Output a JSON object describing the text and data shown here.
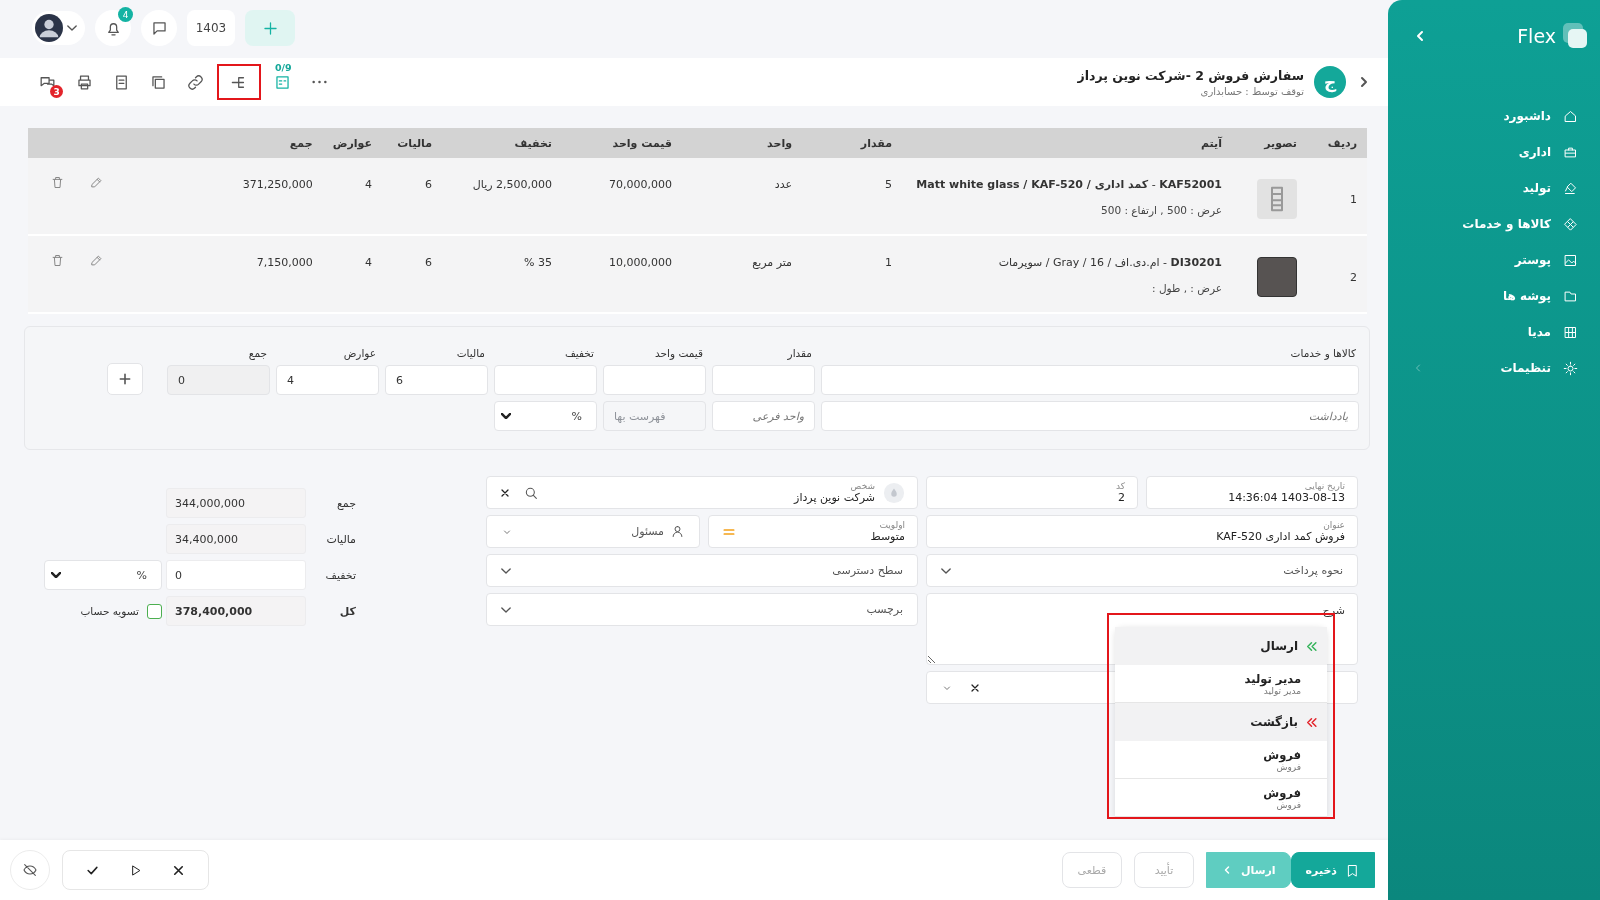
{
  "topbar": {
    "notifications": "4",
    "year": "1403"
  },
  "header": {
    "avatar_letter": "ج",
    "title": "سفارش فروش 2 -شرکت نوین پرداز",
    "subtitle": "توقف توسط : حسابداری",
    "toolbar": [
      {
        "kind": "more",
        "highlighted": false
      },
      {
        "kind": "tasks",
        "badge": "0/9",
        "highlighted": false
      },
      {
        "kind": "workflow",
        "highlighted": true
      },
      {
        "kind": "link",
        "highlighted": false
      },
      {
        "kind": "copy",
        "highlighted": false
      },
      {
        "kind": "notes",
        "highlighted": false
      },
      {
        "kind": "print",
        "highlighted": false
      },
      {
        "kind": "comments",
        "badge": "3",
        "highlighted": false
      }
    ]
  },
  "table": {
    "columns": [
      "ردیف",
      "تصویر",
      "آیتم",
      "مقدار",
      "واحد",
      "قیمت واحد",
      "تخفیف",
      "مالیات",
      "عوارض",
      "جمع"
    ],
    "rows": [
      {
        "index": "1",
        "kind": "shelf",
        "label": "**Matt white glass / KAF-520 / کمد اداری**  -  **KAF52001**",
        "details": "عرض : 500 ,  ارتفاع : 500",
        "qty": "5",
        "unit": "عدد",
        "price": "70,000,000",
        "discount": "2,500,000 ریال",
        "tax": "6",
        "duties": "4",
        "total": "371,250,000"
      },
      {
        "index": "2",
        "kind": "dark",
        "label": "سوپرمات / Gray / 16 / ام.دی.اف  -  **DI30201**",
        "details": "عرض : ,  طول :",
        "qty": "1",
        "unit": "متر مربع",
        "price": "10,000,000",
        "discount": "35 %",
        "tax": "6",
        "duties": "4",
        "total": "7,150,000"
      }
    ]
  },
  "add_form": {
    "labels": [
      "کالاها و خدمات",
      "مقدار",
      "قیمت واحد",
      "تخفیف",
      "مالیات",
      "عوارض",
      "جمع"
    ],
    "values": {
      "tax": "6",
      "duties": "4",
      "total": "0"
    },
    "note": {
      "placeholder": "یادداشت"
    },
    "sub_unit": {
      "placeholder": "واحد فرعی"
    },
    "price_list": {
      "placeholder": "فهرست بها",
      "disabled": true
    },
    "discount_type": "%"
  },
  "details": {
    "final_date": {
      "label": "تاریخ نهایی",
      "value": "1403-08-13 14:36:04"
    },
    "code": {
      "label": "کد",
      "value": "2"
    },
    "person": {
      "label": "شخص",
      "value": "شرکت نوین پرداز"
    },
    "title": {
      "label": "عنوان",
      "value": "فروش کمد اداری  KAF-520"
    },
    "priority": {
      "label": "اولویت",
      "value": "متوسط"
    },
    "responsible": {
      "placeholder": "مسئول"
    },
    "payment": {
      "placeholder": "نحوه پرداخت"
    },
    "access": {
      "placeholder": "سطح دسترسی"
    },
    "tag": {
      "placeholder": "برچسب"
    },
    "description": {
      "placeholder": "شرح"
    }
  },
  "totals": {
    "sum": {
      "label": "جمع",
      "value": "344,000,000"
    },
    "tax": {
      "label": "مالیات",
      "value": "34,400,000"
    },
    "discount": {
      "label": "تخفیف",
      "value": "0",
      "type": "%"
    },
    "total": {
      "label": "کل",
      "value": "378,400,000"
    },
    "settle": {
      "label": "تسویه حساب",
      "checked": false
    }
  },
  "workflow_menu": {
    "highlighted": true,
    "groups": [
      {
        "kind": "send",
        "title": "ارسال",
        "items": [
          {
            "name": "مدیر تولید",
            "sub": "مدیر تولید"
          }
        ]
      },
      {
        "kind": "return",
        "title": "بازگشت",
        "items": [
          {
            "name": "فروش",
            "sub": "فروش"
          },
          {
            "name": "فروش",
            "sub": "فروش"
          }
        ]
      }
    ]
  },
  "footer": {
    "buttons": [
      {
        "kind": "save",
        "label": "ذخیره",
        "disabled": false
      },
      {
        "kind": "send",
        "label": "ارسال",
        "disabled": false
      },
      {
        "kind": "confirm",
        "label": "تأیید",
        "disabled": true
      },
      {
        "kind": "final",
        "label": "قطعی",
        "disabled": true
      }
    ]
  },
  "sidebar": {
    "brand": "Flex",
    "items": [
      {
        "label": "داشبورد",
        "kind": "home",
        "expandable": false
      },
      {
        "label": "اداری",
        "kind": "briefcase",
        "expandable": false
      },
      {
        "label": "تولید",
        "kind": "brush",
        "expandable": false
      },
      {
        "label": "کالاها و خدمات",
        "kind": "diamond",
        "expandable": false
      },
      {
        "label": "پوستر",
        "kind": "image",
        "expandable": false
      },
      {
        "label": "پوشه ها",
        "kind": "folder",
        "expandable": false
      },
      {
        "label": "مدیا",
        "kind": "grid",
        "expandable": false
      },
      {
        "label": "تنظیمات",
        "kind": "gear",
        "expandable": true
      }
    ]
  }
}
